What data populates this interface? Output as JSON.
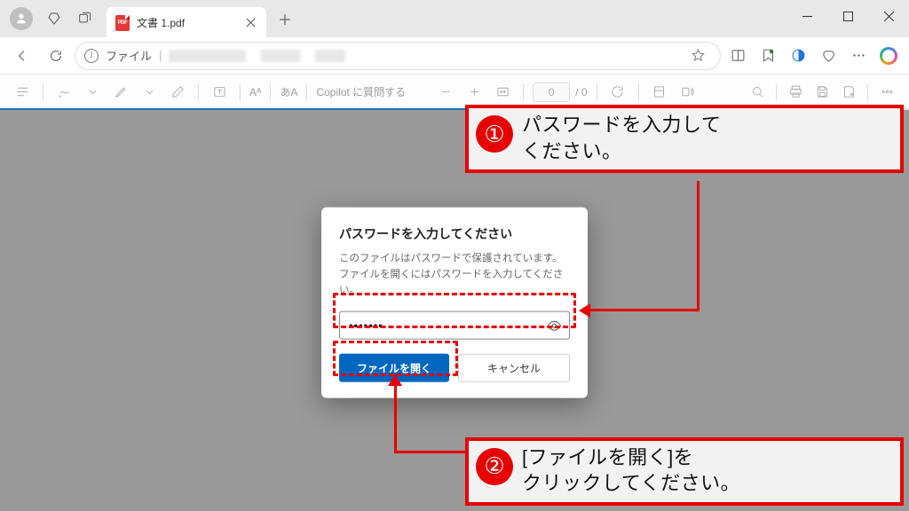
{
  "window": {
    "tab_title": "文書 1.pdf"
  },
  "addressbar": {
    "scheme_label": "ファイル"
  },
  "pdftoolbar": {
    "aA": "Aᴬ",
    "aa": "あA",
    "ask_copilot": "Copilot に質問する",
    "page_current": "0",
    "page_sep": "/",
    "page_total": "0"
  },
  "dialog": {
    "title": "パスワードを入力してください",
    "message": "このファイルはパスワードで保護されています。ファイルを開くにはパスワードを入力してください。",
    "password_value": "•••••••",
    "open_label": "ファイルを開く",
    "cancel_label": "キャンセル"
  },
  "callouts": {
    "c1_num": "①",
    "c1_text": "パスワードを入力して\nください。",
    "c2_num": "②",
    "c2_text": "[ファイルを開く]を\nクリックしてください。"
  }
}
